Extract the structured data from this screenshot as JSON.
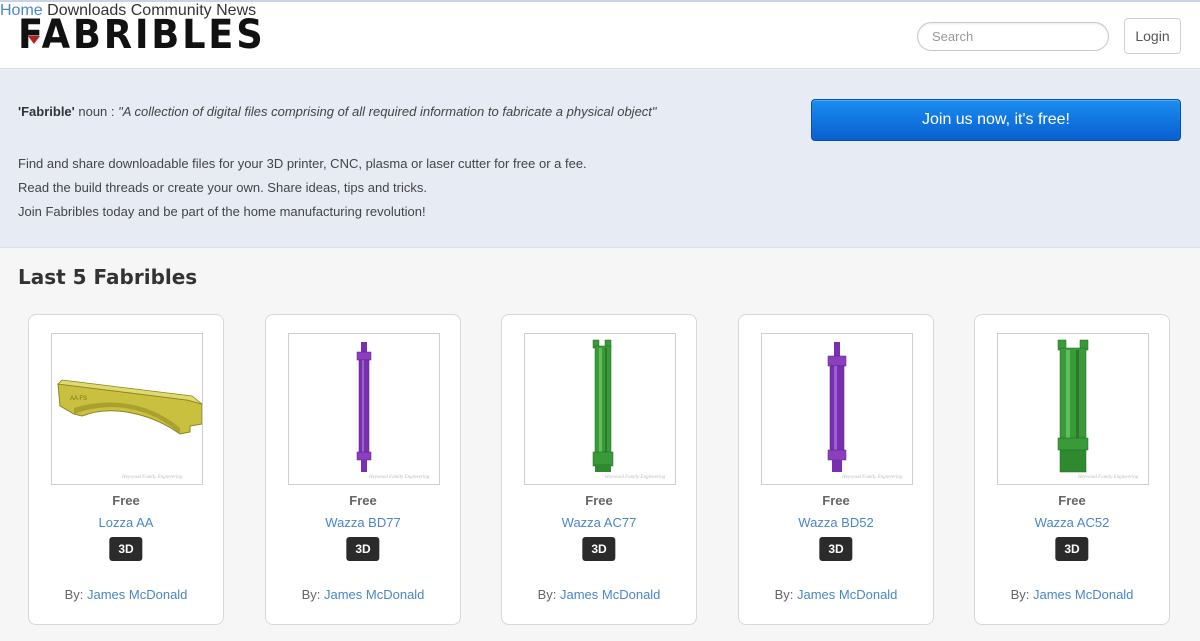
{
  "header": {
    "logo_text": "FABRIBLES",
    "nav": [
      {
        "label": "Home",
        "active": true
      },
      {
        "label": "Downloads",
        "active": false
      },
      {
        "label": "Community",
        "active": false
      },
      {
        "label": "News",
        "active": false
      }
    ],
    "search_placeholder": "Search",
    "login_label": "Login"
  },
  "hero": {
    "definition_term": "'Fabrible'",
    "definition_pos": " noun : ",
    "definition_quote": "\"A collection of digital files comprising of all required information to fabricate a physical object\"",
    "lines": [
      "Find and share downloadable files for your 3D printer, CNC, plasma or laser cutter for free or a fee.",
      "Read the build threads or create your own. Share ideas, tips and tricks.",
      "Join Fabribles today and be part of the home manufacturing revolution!"
    ],
    "join_label": "Join us now, it's free!"
  },
  "section_title": "Last 5 Fabribles",
  "items": [
    {
      "price": "Free",
      "name": "Lozza AA",
      "badge": "3D",
      "by_label": "By:",
      "author": "James McDonald",
      "thumb_icon": "yellow-bracket-model",
      "color": "#c9c040"
    },
    {
      "price": "Free",
      "name": "Wazza BD77",
      "badge": "3D",
      "by_label": "By:",
      "author": "James McDonald",
      "thumb_icon": "purple-rod-model",
      "color": "#7a2fb0"
    },
    {
      "price": "Free",
      "name": "Wazza AC77",
      "badge": "3D",
      "by_label": "By:",
      "author": "James McDonald",
      "thumb_icon": "green-rod-model",
      "color": "#3a9a3a"
    },
    {
      "price": "Free",
      "name": "Wazza BD52",
      "badge": "3D",
      "by_label": "By:",
      "author": "James McDonald",
      "thumb_icon": "purple-rod-model",
      "color": "#7a2fb0"
    },
    {
      "price": "Free",
      "name": "Wazza AC52",
      "badge": "3D",
      "by_label": "By:",
      "author": "James McDonald",
      "thumb_icon": "green-rod-model",
      "color": "#3a9a3a"
    }
  ],
  "colors": {
    "accent_link": "#4a86c8",
    "nav_active": "#4a86c8",
    "join_button": "#0a6fe0",
    "hero_bg": "#e6ebf4"
  }
}
